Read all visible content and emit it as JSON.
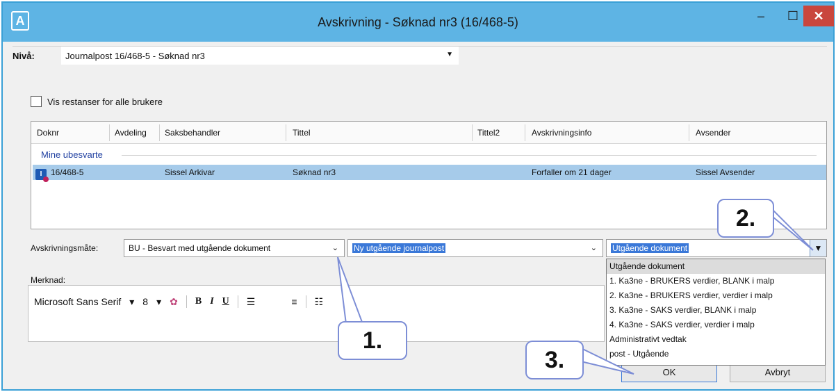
{
  "window": {
    "title": "Avskrivning - Søknad nr3 (16/468-5)",
    "app_icon_letter": "A",
    "minimize_glyph": "–",
    "maximize_glyph": "☐",
    "close_glyph": "✕"
  },
  "niva": {
    "label": "Nivå:",
    "value": "Journalpost 16/468-5 - Søknad nr3"
  },
  "filter": {
    "checkbox_label": "Vis restanser for alle brukere"
  },
  "grid": {
    "columns": [
      "Doknr",
      "Avdeling",
      "Saksbehandler",
      "Tittel",
      "Tittel2",
      "Avskrivningsinfo",
      "Avsender"
    ],
    "group_label": "Mine ubesvarte",
    "rows": [
      {
        "doknr": "16/468-5",
        "avdeling": "",
        "saksbehandler": "Sissel Arkivar",
        "tittel": "Søknad nr3",
        "tittel2": "",
        "avskrivningsinfo": "Forfaller om 21 dager",
        "avsender": "Sissel Avsender"
      }
    ]
  },
  "avskrivning": {
    "label": "Avskrivningsmåte:",
    "mode_value": "BU - Besvart med utgående dokument",
    "journalpost_value": "Ny utgående journalpost",
    "document_value": "Utgående dokument"
  },
  "dropdown": {
    "items": [
      "Utgående dokument",
      "1. Ka3ne - BRUKERS verdier, BLANK i malp",
      "2. Ka3ne - BRUKERS verdier, verdier i malp",
      "3. Ka3ne - SAKS verdier, BLANK i malp",
      "4. Ka3ne - SAKS verdier, verdier i malp",
      "Administrativt vedtak",
      "post - Utgående"
    ]
  },
  "merknad": {
    "label": "Merknad:",
    "font_name": "Microsoft Sans Serif",
    "font_size": "8",
    "bold": "B",
    "italic": "I",
    "underline": "U"
  },
  "buttons": {
    "ok": "OK",
    "cancel": "Avbryt"
  },
  "callouts": {
    "one": "1.",
    "two": "2.",
    "three": "3."
  },
  "colors": {
    "titlebar": "#5eb4e4",
    "selection": "#a6cbea",
    "highlight": "#3a78d8",
    "callout_border": "#7d8ed6"
  }
}
